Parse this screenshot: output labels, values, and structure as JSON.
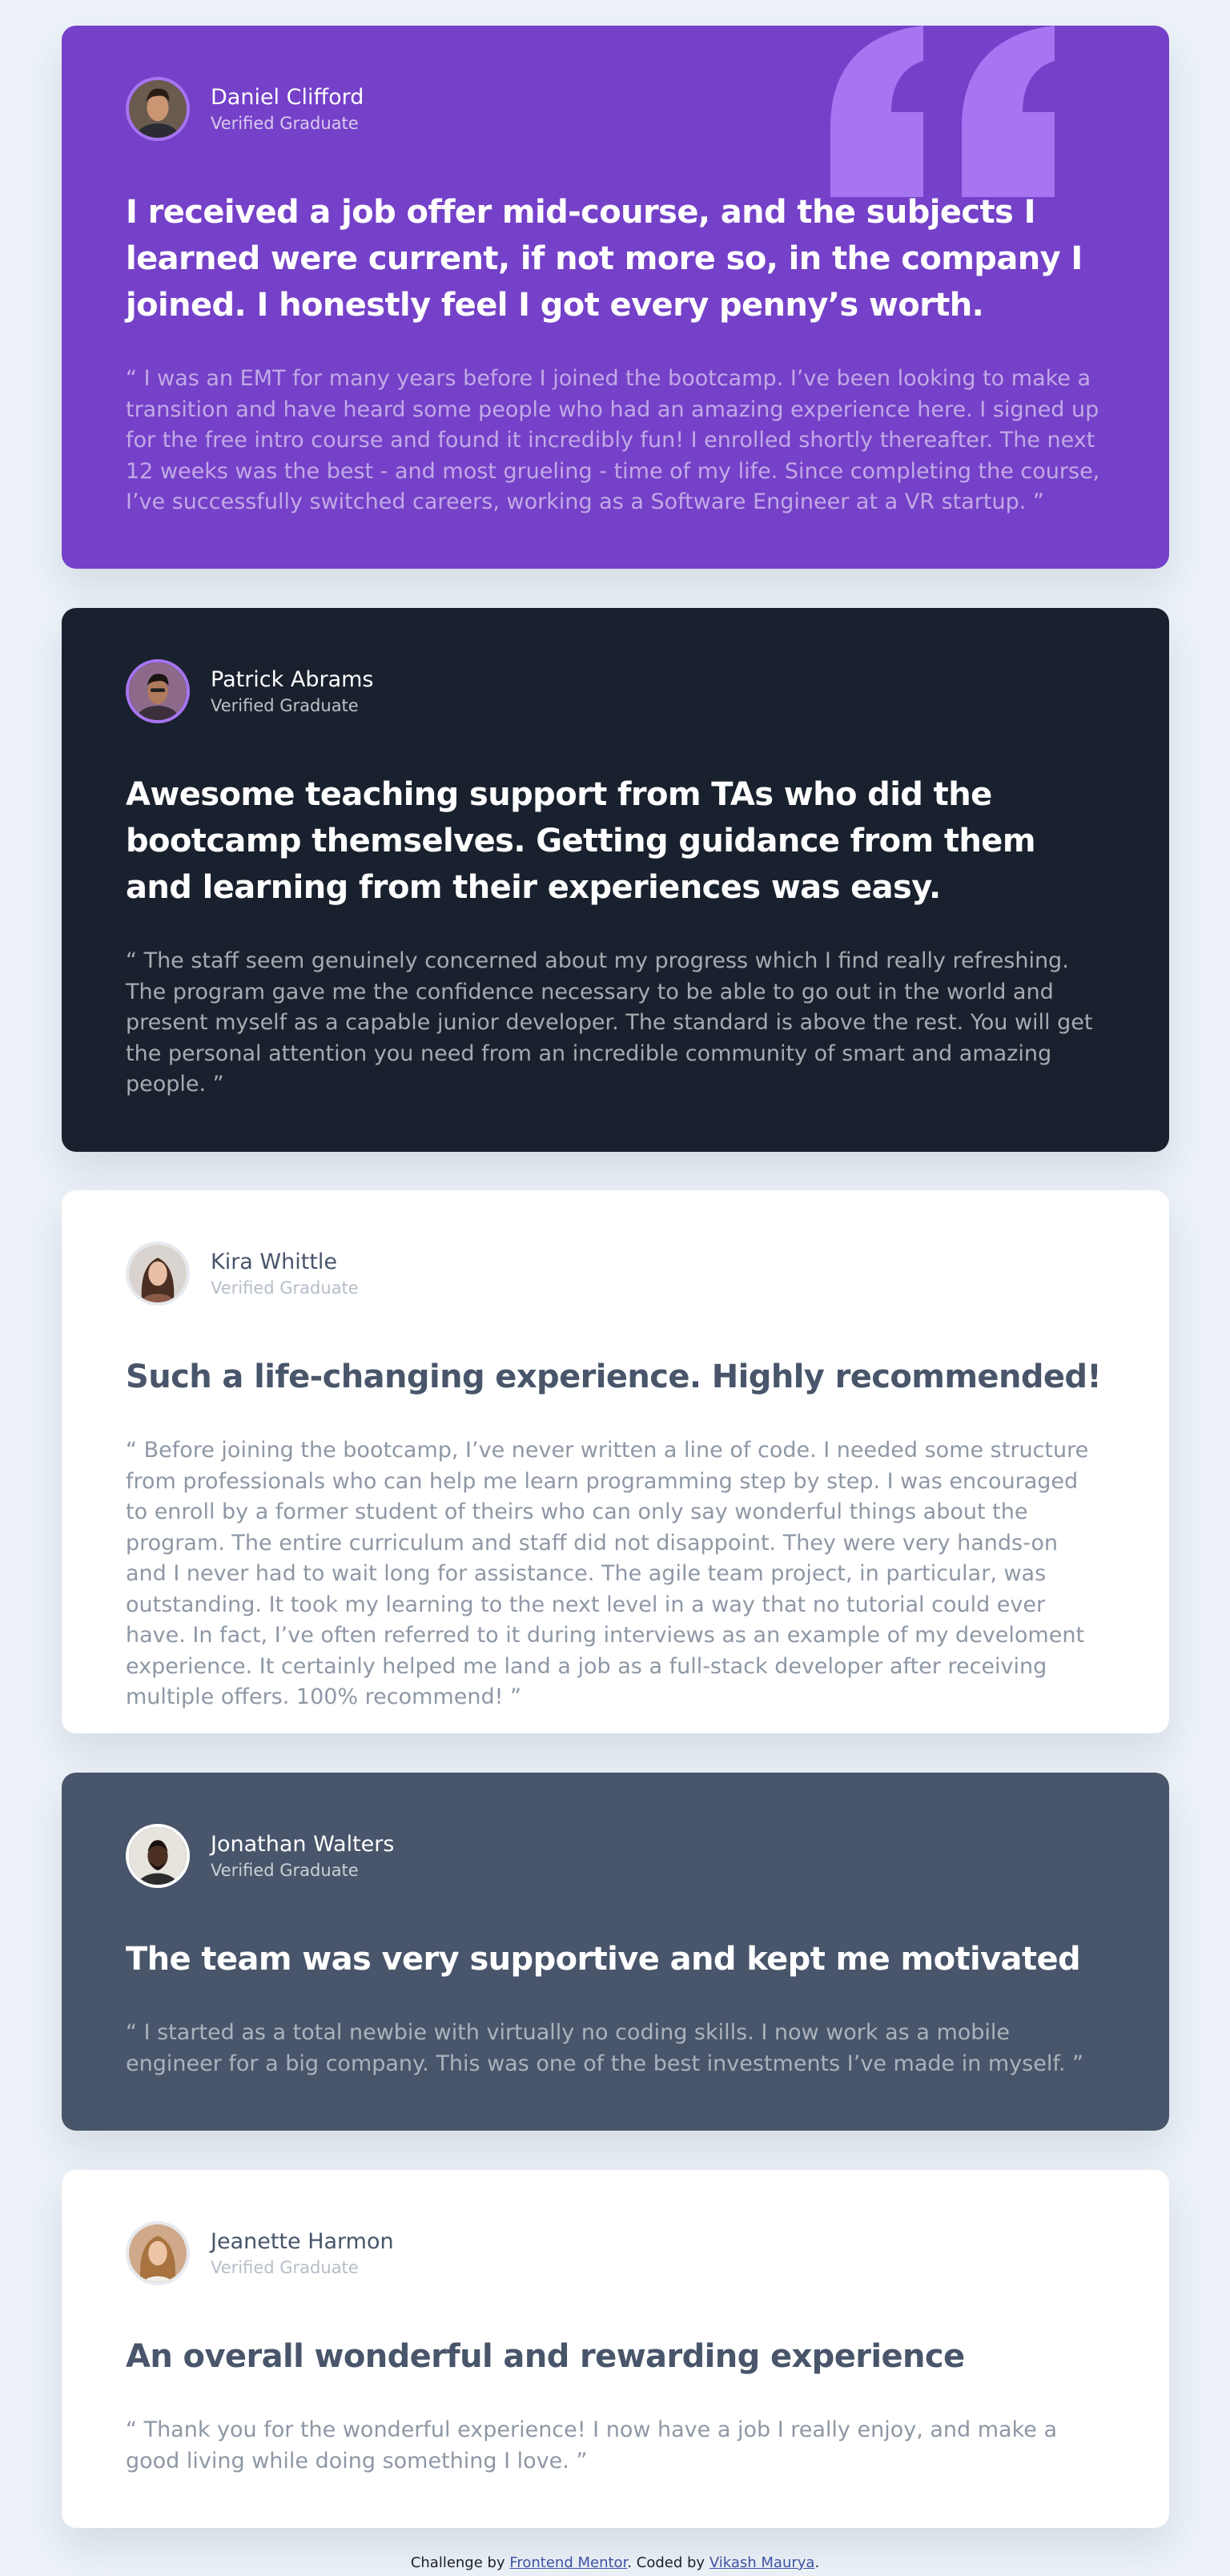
{
  "colors": {
    "page_background": "#ecf2f8",
    "violet": "#7541c8",
    "very_dark_blackish_blue": "#19212e",
    "grayish_blue": "#48556a",
    "white": "#ffffff",
    "quote_mark": "#a775f1"
  },
  "testimonials": [
    {
      "name": "Daniel Clifford",
      "role": "Verified Graduate",
      "headline": "I received a job offer mid-course, and the subjects I learned were current, if not more so, in the company I joined. I honestly feel I got every penny’s worth.",
      "quote": "“ I was an EMT for many years before I joined the bootcamp. I’ve been looking to make a transition and have heard some people who had an amazing experience here. I signed up for the free intro course and found it incredibly fun! I enrolled shortly thereafter. The next 12 weeks was the best - and most grueling - time of my life. Since completing the course, I’ve successfully switched careers, working as a Software Engineer at a VR startup. ”",
      "theme": "violet"
    },
    {
      "name": "Patrick Abrams",
      "role": "Verified Graduate",
      "headline": "Awesome teaching support from TAs who did the bootcamp themselves. Getting guidance from them and learning from their experiences was easy.",
      "quote": "“ The staff seem genuinely concerned about my progress which I find really refreshing. The program gave me the confidence necessary to be able to go out in the world and present myself as a capable junior developer. The standard is above the rest. You will get the personal attention you need from an incredible community of smart and amazing people. ”",
      "theme": "very-dark-blackish-blue"
    },
    {
      "name": "Kira Whittle",
      "role": "Verified Graduate",
      "headline": "Such a life-changing experience. Highly recommended!",
      "quote": "“ Before joining the bootcamp, I’ve never written a line of code. I needed some structure from professionals who can help me learn programming step by step. I was encouraged to enroll by a former student of theirs who can only say wonderful things about the program. The entire curriculum and staff did not disappoint. They were very hands-on and I never had to wait long for assistance. The agile team project, in particular, was outstanding. It took my learning to the next level in a way that no tutorial could ever have. In fact, I’ve often referred to it during interviews as an example of my develoment experience. It certainly helped me land a job as a full-stack developer after receiving multiple offers. 100% recommend! ”",
      "theme": "white"
    },
    {
      "name": "Jonathan Walters",
      "role": "Verified Graduate",
      "headline": "The team was very supportive and kept me motivated",
      "quote": "“ I started as a total newbie with virtually no coding skills. I now work as a mobile engineer for a big company. This was one of the best investments I’ve made in myself. ”",
      "theme": "grayish-blue"
    },
    {
      "name": "Jeanette Harmon",
      "role": "Verified Graduate",
      "headline": "An overall wonderful and rewarding experience",
      "quote": "“ Thank you for the wonderful experience! I now have a job I really enjoy, and make a good living while doing something I love. ”",
      "theme": "white"
    }
  ],
  "decorations": {
    "quote_icon": "quotation-mark-icon"
  },
  "footer": {
    "prefix": "Challenge by ",
    "challenge_link": "Frontend Mentor",
    "middle": ". Coded by ",
    "author_link": "Vikash Maurya",
    "suffix": "."
  }
}
